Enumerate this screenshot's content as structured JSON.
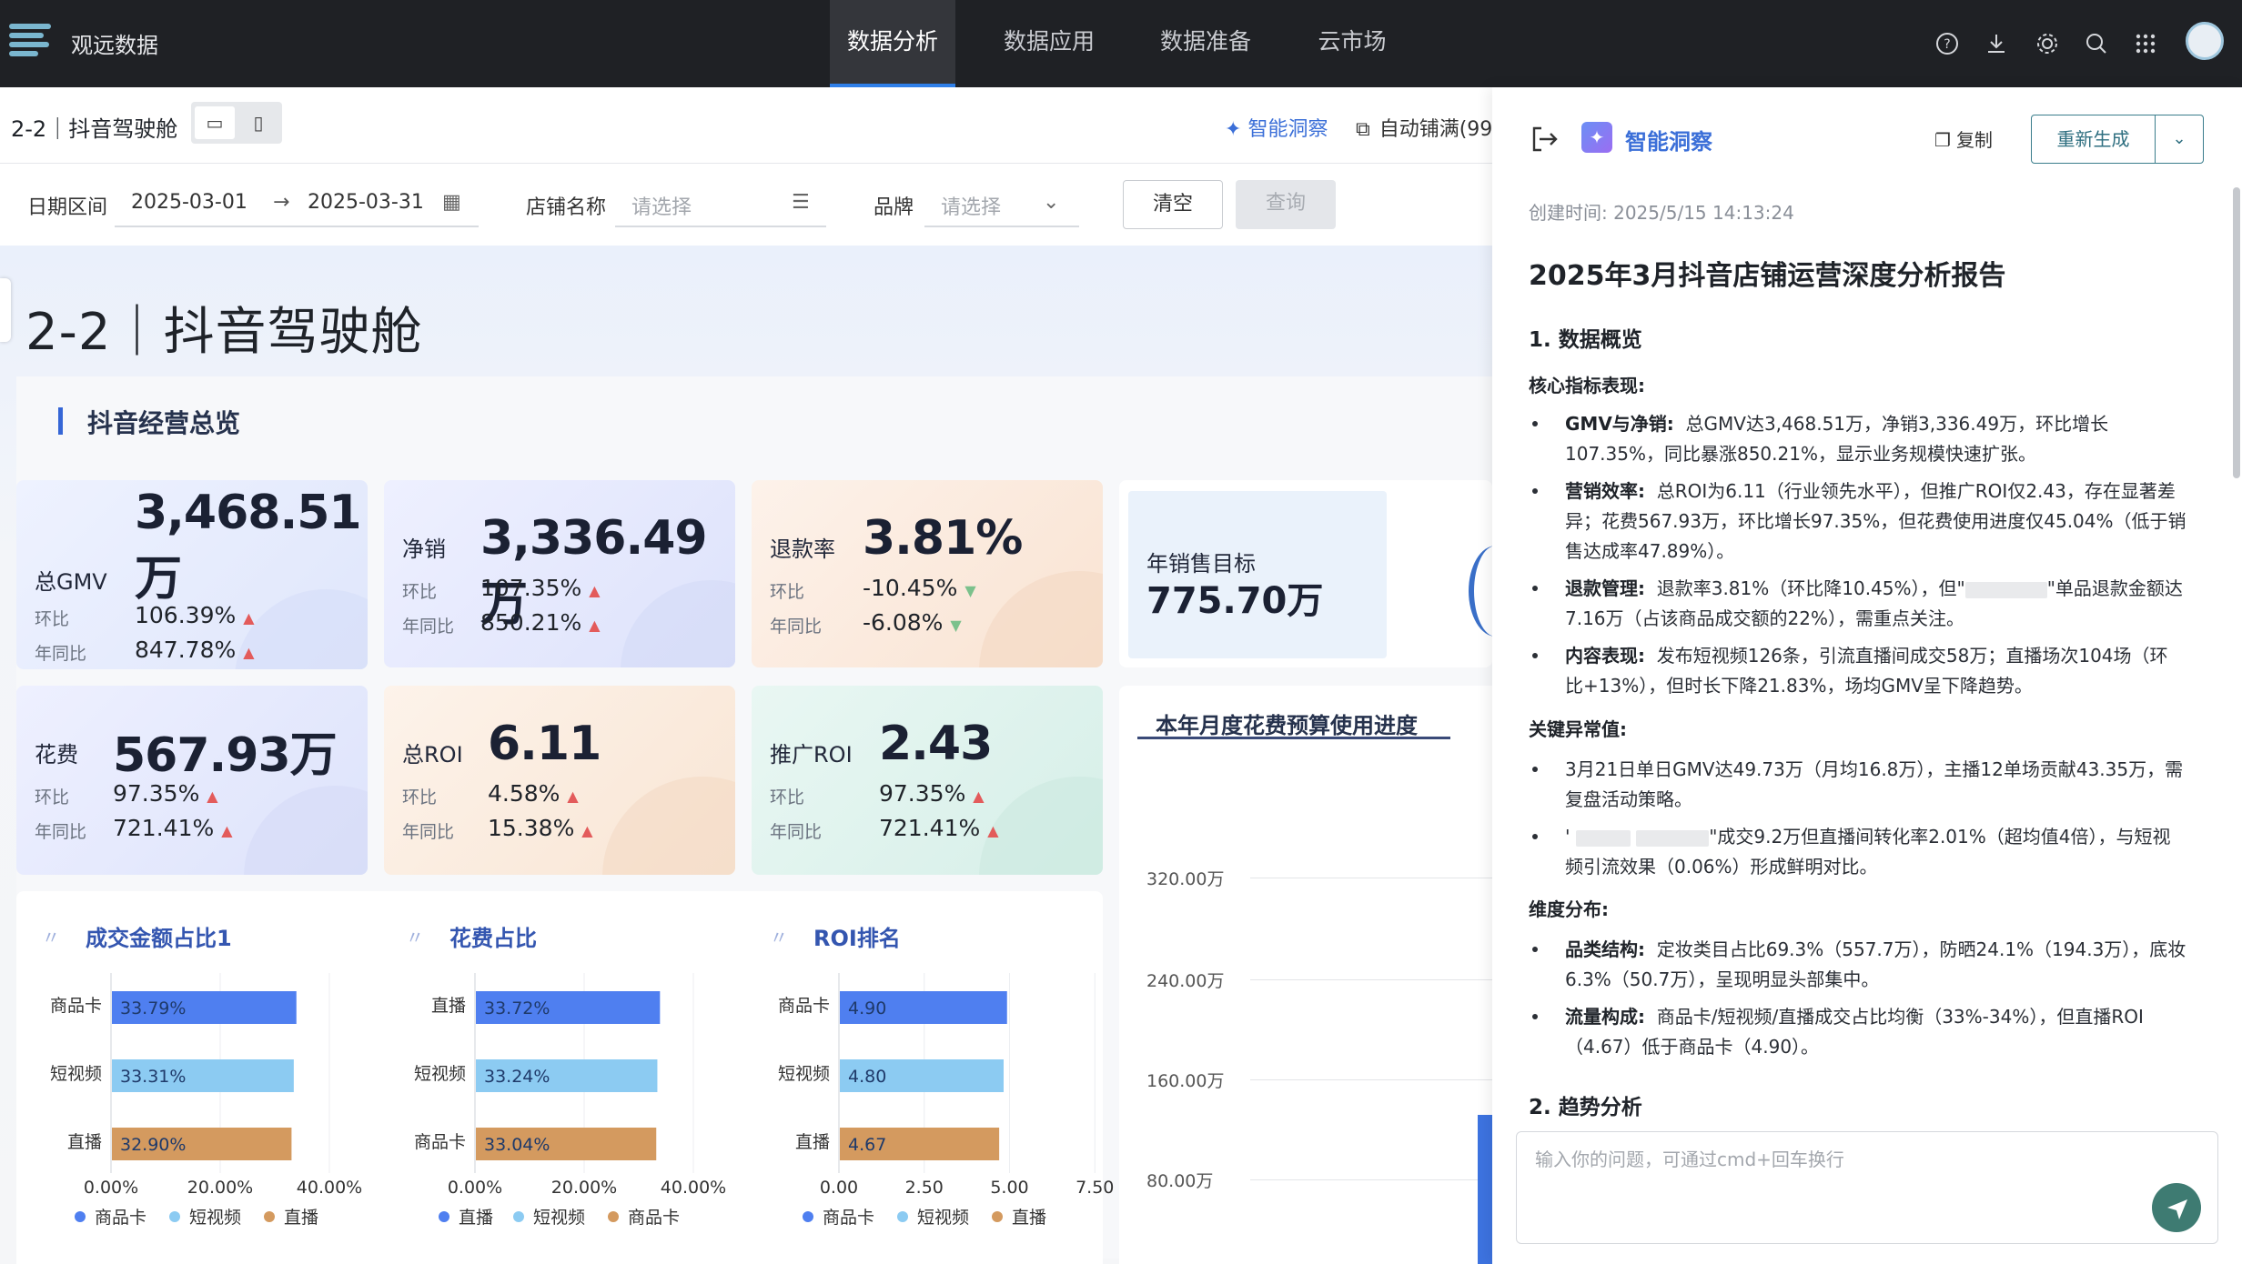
{
  "topbar": {
    "app_title": "观远数据",
    "tabs": [
      {
        "label": "数据分析",
        "active": true
      },
      {
        "label": "数据应用",
        "active": false
      },
      {
        "label": "数据准备",
        "active": false
      },
      {
        "label": "云市场",
        "active": false
      }
    ],
    "icons": [
      "help-icon",
      "download-icon",
      "settings-icon",
      "search-icon",
      "apps-grid-icon"
    ]
  },
  "page": {
    "name": "2-2｜抖音驾驶舱",
    "smart_insight": "智能洞察",
    "auto_fill": "自动铺满(99"
  },
  "filters": {
    "date_label": "日期区间",
    "date_start": "2025-03-01",
    "date_end": "2025-03-31",
    "store_label": "店铺名称",
    "store_placeholder": "请选择",
    "brand_label": "品牌",
    "brand_placeholder": "请选择",
    "clear_label": "清空",
    "query_label": "查询"
  },
  "dashboard": {
    "title": "2-2｜抖音驾驶舱",
    "section_title": "抖音经营总览",
    "kpis": [
      {
        "label": "总GMV",
        "value": "3,468.51",
        "value2": "万",
        "mom_label": "环比",
        "mom": "106.39%",
        "mom_dir": "up",
        "yoy_label": "年同比",
        "yoy": "847.78%",
        "yoy_dir": "up"
      },
      {
        "label": "净销",
        "value": "3,336.49万",
        "mom_label": "环比",
        "mom": "107.35%",
        "mom_dir": "up",
        "yoy_label": "年同比",
        "yoy": "850.21%",
        "yoy_dir": "up"
      },
      {
        "label": "退款率",
        "value": "3.81%",
        "mom_label": "环比",
        "mom": "-10.45%",
        "mom_dir": "down",
        "yoy_label": "年同比",
        "yoy": "-6.08%",
        "yoy_dir": "down"
      },
      {
        "label": "花费",
        "value": "567.93万",
        "mom_label": "环比",
        "mom": "97.35%",
        "mom_dir": "up",
        "yoy_label": "年同比",
        "yoy": "721.41%",
        "yoy_dir": "up"
      },
      {
        "label": "总ROI",
        "value": "6.11",
        "mom_label": "环比",
        "mom": "4.58%",
        "mom_dir": "up",
        "yoy_label": "年同比",
        "yoy": "15.38%",
        "yoy_dir": "up"
      },
      {
        "label": "推广ROI",
        "value": "2.43",
        "mom_label": "环比",
        "mom": "97.35%",
        "mom_dir": "up",
        "yoy_label": "年同比",
        "yoy": "721.41%",
        "yoy_dir": "up"
      }
    ],
    "target": {
      "label": "年销售目标",
      "value": "775.70万"
    },
    "budget_title": "本年月度花费预算使用进度",
    "budget_ticks": [
      "320.00万",
      "240.00万",
      "160.00万",
      "80.00万"
    ]
  },
  "colors": {
    "blue": "#4f7ff0",
    "lightblue": "#8ccbf2",
    "orange": "#d49a5f",
    "accent": "#3566d6"
  },
  "chart_data": [
    {
      "type": "bar",
      "title": "成交金额占比1",
      "orientation": "horizontal",
      "categories": [
        "商品卡",
        "短视频",
        "直播"
      ],
      "values": [
        33.79,
        33.31,
        32.9
      ],
      "labels": [
        "33.79%",
        "33.31%",
        "32.90%"
      ],
      "bar_colors": [
        "#4f7ff0",
        "#8ccbf2",
        "#d49a5f"
      ],
      "xlim": [
        0,
        50
      ],
      "xticks": [
        "0.00%",
        "20.00%",
        "40.00%"
      ],
      "xtick_values": [
        0,
        20,
        40
      ],
      "legend": [
        "商品卡",
        "短视频",
        "直播"
      ],
      "legend_position": "bottom"
    },
    {
      "type": "bar",
      "title": "花费占比",
      "orientation": "horizontal",
      "categories": [
        "直播",
        "短视频",
        "商品卡"
      ],
      "values": [
        33.72,
        33.24,
        33.04
      ],
      "labels": [
        "33.72%",
        "33.24%",
        "33.04%"
      ],
      "bar_colors": [
        "#4f7ff0",
        "#8ccbf2",
        "#d49a5f"
      ],
      "xlim": [
        0,
        50
      ],
      "xticks": [
        "0.00%",
        "20.00%",
        "40.00%"
      ],
      "xtick_values": [
        0,
        20,
        40
      ],
      "legend": [
        "直播",
        "短视频",
        "商品卡"
      ],
      "legend_position": "bottom"
    },
    {
      "type": "bar",
      "title": "ROI排名",
      "orientation": "horizontal",
      "categories": [
        "商品卡",
        "短视频",
        "直播"
      ],
      "values": [
        4.9,
        4.8,
        4.67
      ],
      "labels": [
        "4.90",
        "4.80",
        "4.67"
      ],
      "bar_colors": [
        "#4f7ff0",
        "#8ccbf2",
        "#d49a5f"
      ],
      "xlim": [
        0,
        8
      ],
      "xticks": [
        "0.00",
        "2.50",
        "5.00",
        "7.50"
      ],
      "xtick_values": [
        0,
        2.5,
        5,
        7.5
      ],
      "legend": [
        "商品卡",
        "短视频",
        "直播"
      ],
      "legend_position": "bottom"
    }
  ],
  "drawer": {
    "title": "智能洞察",
    "copy_label": "复制",
    "regenerate_label": "重新生成",
    "created": "创建时间: 2025/5/15 14:13:24",
    "report_title": "2025年3月抖音店铺运营深度分析报告",
    "h_overview": "1. 数据概览",
    "core_label": "核心指标表现:",
    "b1_key": "GMV与净销:",
    "b1_l1": "总GMV达3,468.51万，净销3,336.49万，环比增长",
    "b1_l2": "107.35%，同比暴涨850.21%，显示业务规模快速扩张。",
    "b2_key": "营销效率:",
    "b2_l1": "总ROI为6.11（行业领先水平），但推广ROI仅2.43，存在显著差",
    "b2_l2": "异；花费567.93万，环比增长97.35%，但花费使用进度仅45.04%（低于销",
    "b2_l3": "售达成率47.89%）。",
    "b3_key": "退款管理:",
    "b3_l1a": "退款率3.81%（环比降10.45%），但\"",
    "b3_l1b": "\"单品退款金额达",
    "b3_l2": "7.16万（占该商品成交额的22%），需重点关注。",
    "b4_key": "内容表现:",
    "b4_l1": "发布短视频126条，引流直播间成交58万；直播场次104场（环",
    "b4_l2": "比+13%），但时长下降21.83%，场均GMV呈下降趋势。",
    "anomaly_label": "关键异常值:",
    "a1_l1": "3月21日单日GMV达49.73万（月均16.8万），主播12单场贡献43.35万，需",
    "a1_l2": "复盘活动策略。",
    "a2_l1a": "'",
    "a2_l1b": "\"成交9.2万但直播间转化率2.01%（超均值4倍），与短视",
    "a2_l2": "频引流效果（0.06%）形成鲜明对比。",
    "dim_label": "维度分布:",
    "d1_key": "品类结构:",
    "d1_l1": "定妆类目占比69.3%（557.7万），防晒24.1%（194.3万），底妆",
    "d1_l2": "6.3%（50.7万），呈现明显头部集中。",
    "d2_key": "流量构成:",
    "d2_l1": "商品卡/短视频/直播成交占比均衡（33%-34%），但直播ROI",
    "d2_l2": "（4.67）低于商品卡（4.90）。",
    "h_trend": "2. 趋势分析",
    "input_placeholder": "输入你的问题，可通过cmd+回车换行"
  }
}
